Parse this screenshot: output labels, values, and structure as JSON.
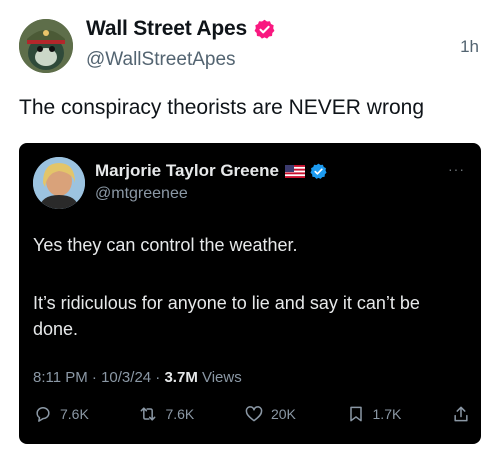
{
  "post": {
    "author_name": "Wall Street Apes",
    "author_handle": "@WallStreetApes",
    "timestamp": "1h",
    "text": "The conspiracy theorists are NEVER wrong",
    "verified_color": "#f91880"
  },
  "quote": {
    "author_name": "Marjorie Taylor Greene",
    "author_handle": "@mtgreenee",
    "more_icon": "···",
    "paragraph_1": "Yes they can control the weather.",
    "paragraph_2": "It’s ridiculous for anyone to lie and say it can’t be done.",
    "meta_time": "8:11 PM · 10/3/24 · ",
    "meta_views_count": "3.7M",
    "meta_views_label": " Views",
    "verified_color": "#1d9bf0",
    "actions": {
      "replies": "7.6K",
      "reposts": "7.6K",
      "likes": "20K",
      "bookmarks": "1.7K"
    },
    "icons": [
      "reply-icon",
      "repost-icon",
      "like-icon",
      "bookmark-icon",
      "share-icon"
    ]
  }
}
